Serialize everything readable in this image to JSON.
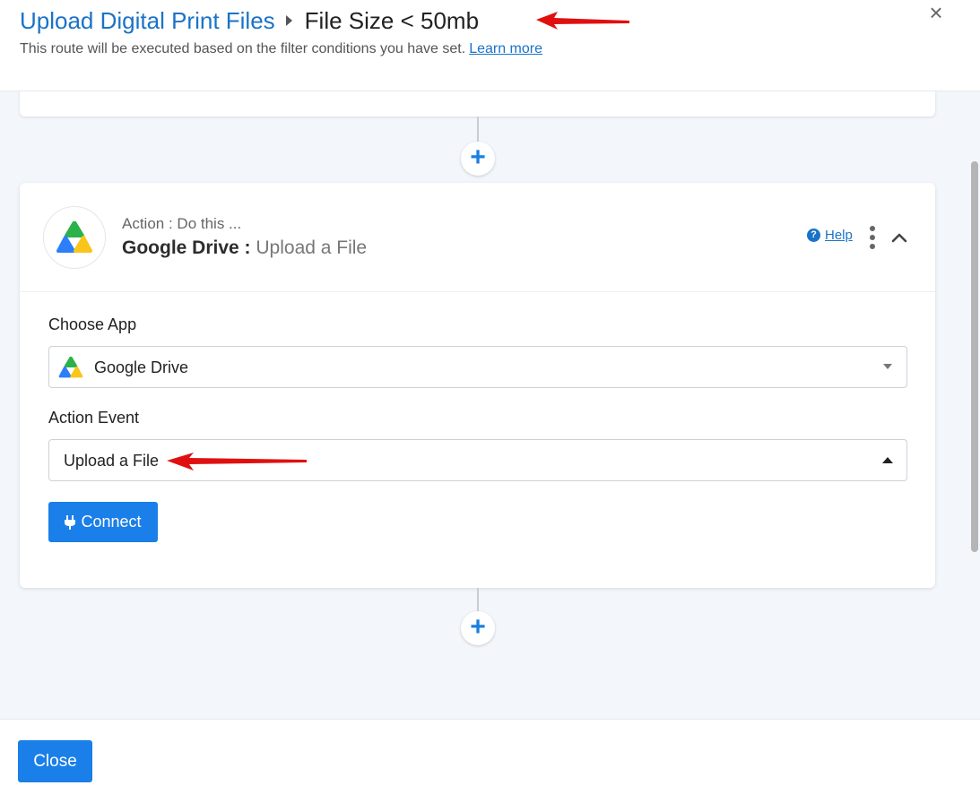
{
  "header": {
    "breadcrumb_parent": "Upload Digital Print Files",
    "breadcrumb_current": "File Size < 50mb",
    "subtitle": "This route will be executed based on the filter conditions you have set.",
    "learn_more": "Learn more",
    "close_icon": "×"
  },
  "action_card": {
    "label": "Action : Do this ...",
    "app_name": "Google Drive",
    "separator": " : ",
    "event_name": "Upload a File",
    "help_icon": "?",
    "help_label": "Help"
  },
  "form": {
    "choose_app_label": "Choose App",
    "choose_app_value": "Google Drive",
    "action_event_label": "Action Event",
    "action_event_value": "Upload a File",
    "connect_label": "Connect"
  },
  "footer": {
    "close_label": "Close"
  },
  "icons": {
    "app": "google-drive-icon",
    "plus": "+",
    "plug": "plug-icon"
  },
  "colors": {
    "primary": "#1a7fe8",
    "link": "#1a73c8",
    "annotation_arrow": "#e01010"
  }
}
